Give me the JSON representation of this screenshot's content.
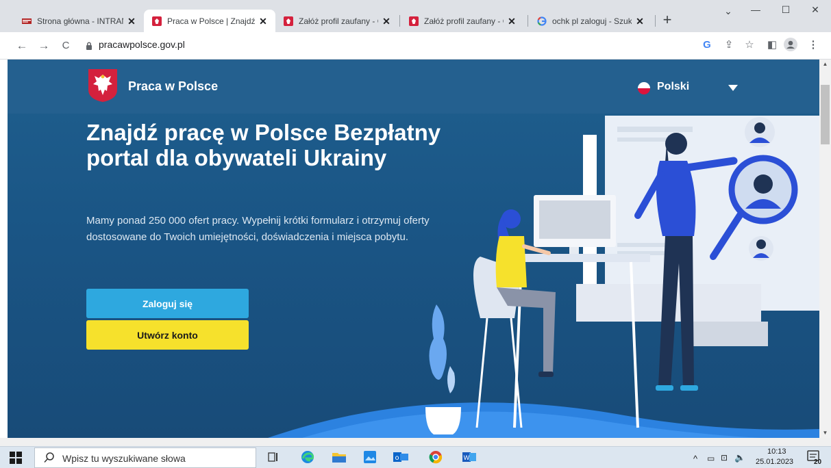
{
  "browser": {
    "tabs": [
      {
        "title": "Strona główna - INTRANET",
        "favicon": "intranet-icon"
      },
      {
        "title": "Praca w Polsce | Znajdź pracę",
        "favicon": "poland-emblem-icon",
        "active": true
      },
      {
        "title": "Załóż profil zaufany - Gov",
        "favicon": "poland-emblem-icon"
      },
      {
        "title": "Załóż profil zaufany - Gov",
        "favicon": "poland-emblem-icon"
      },
      {
        "title": "ochk pl zaloguj - Szukaj w Google",
        "favicon": "google-icon"
      }
    ],
    "close_glyph": "✕",
    "new_tab_glyph": "+",
    "url": "pracawpolsce.gov.pl",
    "window_controls": {
      "minimize": "—",
      "maximize": "☐",
      "close": "✕",
      "menu": "⌄"
    },
    "toolbar_glyphs": {
      "back": "←",
      "forward": "→",
      "reload": "C",
      "google": "G",
      "share": "⇪",
      "star": "☆",
      "sidebar": "◧",
      "menu": "⋮"
    }
  },
  "page": {
    "site_name": "Praca w Polsce",
    "language": "Polski",
    "headline": "Znajdź pracę w Polsce Bezpłatny portal dla obywateli Ukrainy",
    "lead": "Mamy ponad 250 000 ofert pracy. Wypełnij krótki formularz i otrzymuj oferty dostosowane do Twoich umiejętności, doświadczenia i miejsca pobytu.",
    "login_button": "Zaloguj się",
    "register_button": "Utwórz konto",
    "colors": {
      "header": "#24608f",
      "background": "#1a5585",
      "login": "#2ea8df",
      "register": "#f6e12c",
      "accent": "#2b4fd6"
    }
  },
  "taskbar": {
    "search_placeholder": "Wpisz tu wyszukiwane słowa",
    "time": "10:13",
    "date": "25.01.2023",
    "notification_count": "20",
    "apps": [
      "task-view-icon",
      "edge-icon",
      "file-explorer-icon",
      "photos-icon",
      "outlook-icon",
      "chrome-icon",
      "word-icon"
    ]
  }
}
